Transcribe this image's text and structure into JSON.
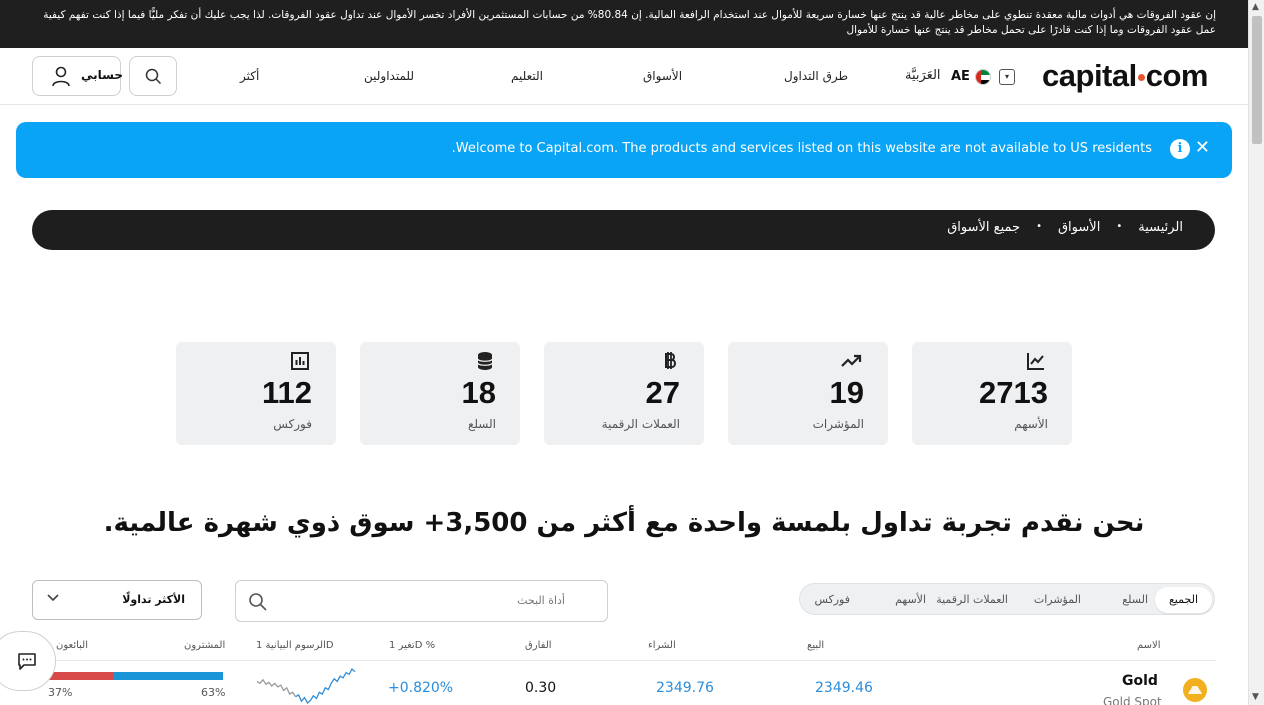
{
  "risk_warning": {
    "line1": "إن عقود الفروقات هي أدوات مالية معقدة تنطوي على مخاطر عالية قد ينتج عنها خسارة سريعة للأموال عند استخدام الرافعة المالية. إن 80.84% من حسابات المستثمرين الأفراد تخسر الأموال عند تداول عقود الفروقات. لذا يجب عليك أن تفكر مليًّا فيما إذا كنت تفهم كيفية",
    "line2": "عمل عقود الفروقات وما إذا كنت قادرًا على تحمل مخاطر قد ينتج عنها خسارة للأموال"
  },
  "header": {
    "logo_left": "capital",
    "logo_right": "com",
    "region": "AE",
    "language": "العَرَبيَّة",
    "nav": [
      "طرق التداول",
      "الأسواق",
      "التعليم",
      "للمتداولين",
      "أكثر"
    ],
    "account_label": "حسابي"
  },
  "info_banner": {
    "message": "Welcome to Capital.com. The products and services listed on this website are not available to US residents."
  },
  "breadcrumb": [
    "الرئيسية",
    "الأسواق",
    "جميع الأسواق"
  ],
  "stats": [
    {
      "value": "2713",
      "label": "الأسهم",
      "icon": "chart-line-icon"
    },
    {
      "value": "19",
      "label": "المؤشرات",
      "icon": "trend-up-icon"
    },
    {
      "value": "27",
      "label": "العملات الرقمية",
      "icon": "bitcoin-icon"
    },
    {
      "value": "18",
      "label": "السلع",
      "icon": "coins-icon"
    },
    {
      "value": "112",
      "label": "فوركس",
      "icon": "bar-chart-icon"
    }
  ],
  "headline": "نحن نقدم تجربة تداول بلمسة واحدة مع أكثر من 3,500+ سوق ذوي شهرة عالمية.",
  "filters": {
    "sort_label": "الأكثر تداولًا",
    "search_placeholder": "أداة البحث",
    "tabs": [
      "الجميع",
      "السلع",
      "المؤشرات",
      "العملات الرقمية",
      "الأسهم",
      "فوركس"
    ],
    "active_tab": "الجميع"
  },
  "table": {
    "columns": [
      "الاسم",
      "البيع",
      "الشراء",
      "الفارق",
      "تغير 1D %",
      "الرسوم البيانية 1D",
      "المشترون",
      "البائعون"
    ],
    "rows": [
      {
        "name": "Gold",
        "subtitle": "Gold Spot",
        "sell": "2349.46",
        "buy": "2349.76",
        "spread": "0.30",
        "change": "+0.820%",
        "buyers": "63%",
        "sellers": "37%",
        "buyers_fraction": 0.63,
        "sparkline": [
          52,
          50,
          54,
          49,
          51,
          47,
          50,
          46,
          48,
          42,
          45,
          38,
          40,
          35,
          37,
          30,
          34,
          28,
          31,
          36,
          33,
          40,
          38,
          45,
          43,
          50,
          55,
          52,
          58,
          56,
          62,
          60,
          66,
          63
        ]
      }
    ]
  },
  "colors": {
    "accent_blue": "#0aa4f6",
    "buyers_blue": "#1a96d8",
    "sellers_red": "#d84a4a",
    "change_blue": "#2b8ddb",
    "logo_dot": "#e4572e"
  }
}
